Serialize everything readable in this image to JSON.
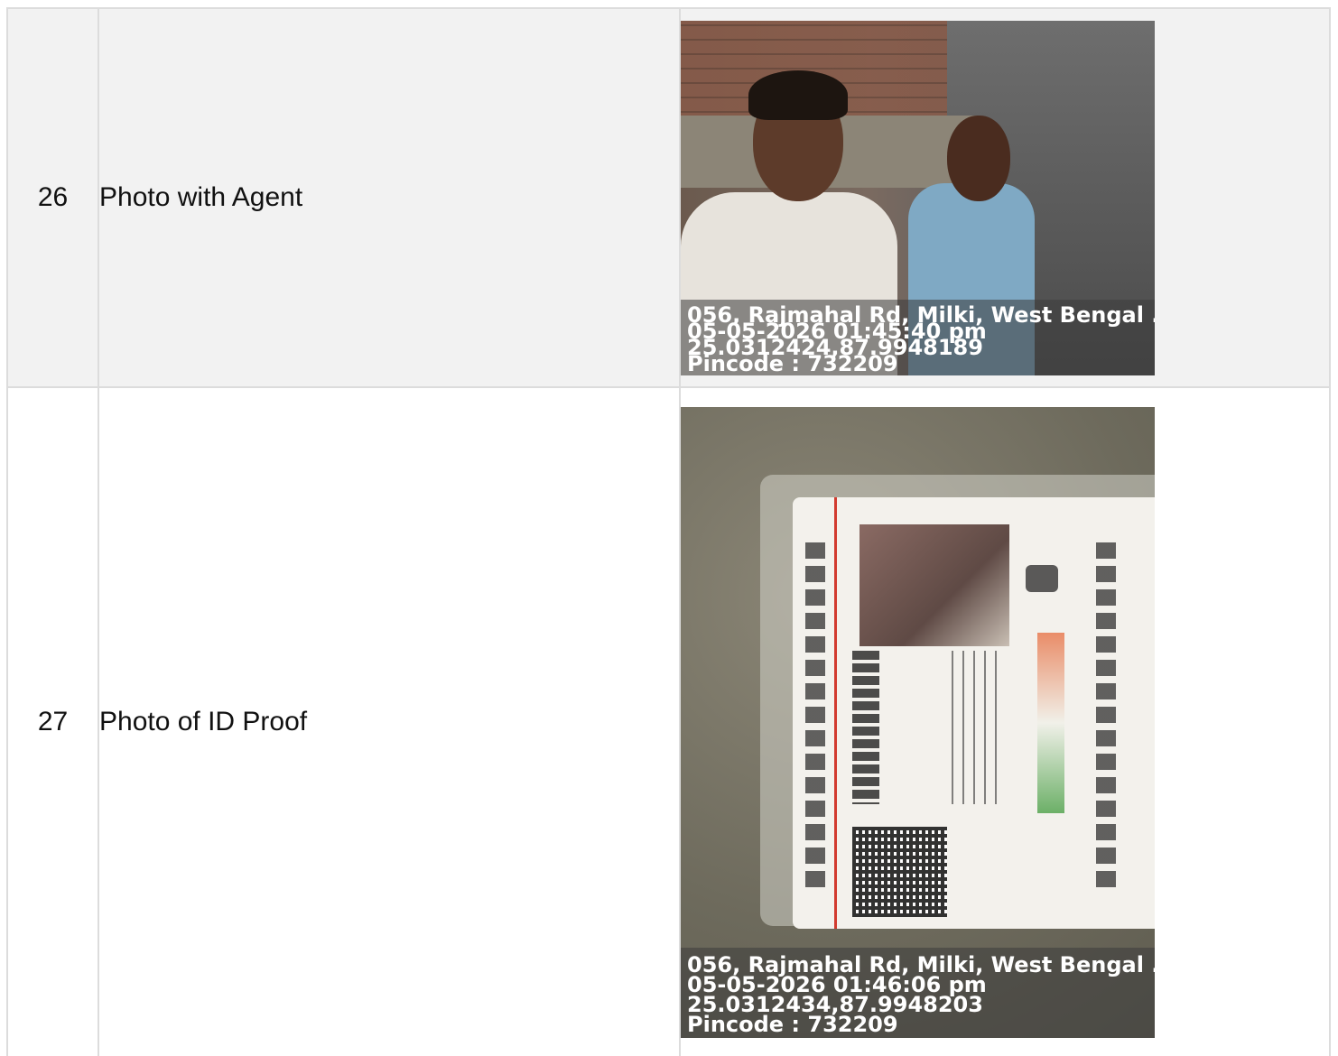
{
  "rows": [
    {
      "number": "26",
      "label": "Photo with Agent",
      "stamp": {
        "address": "056, Rajmahal Rd, Milki, West Bengal ...",
        "datetime": "05-05-2026 01:45:40 pm",
        "coords": "25.0312424,87.9948189",
        "pincode": "Pincode : 732209"
      }
    },
    {
      "number": "27",
      "label": "Photo of ID Proof",
      "stamp": {
        "address": "056, Rajmahal Rd, Milki, West Bengal ...",
        "datetime": "05-05-2026 01:46:06 pm",
        "coords": "25.0312434,87.9948203",
        "pincode": "Pincode : 732209"
      }
    }
  ]
}
